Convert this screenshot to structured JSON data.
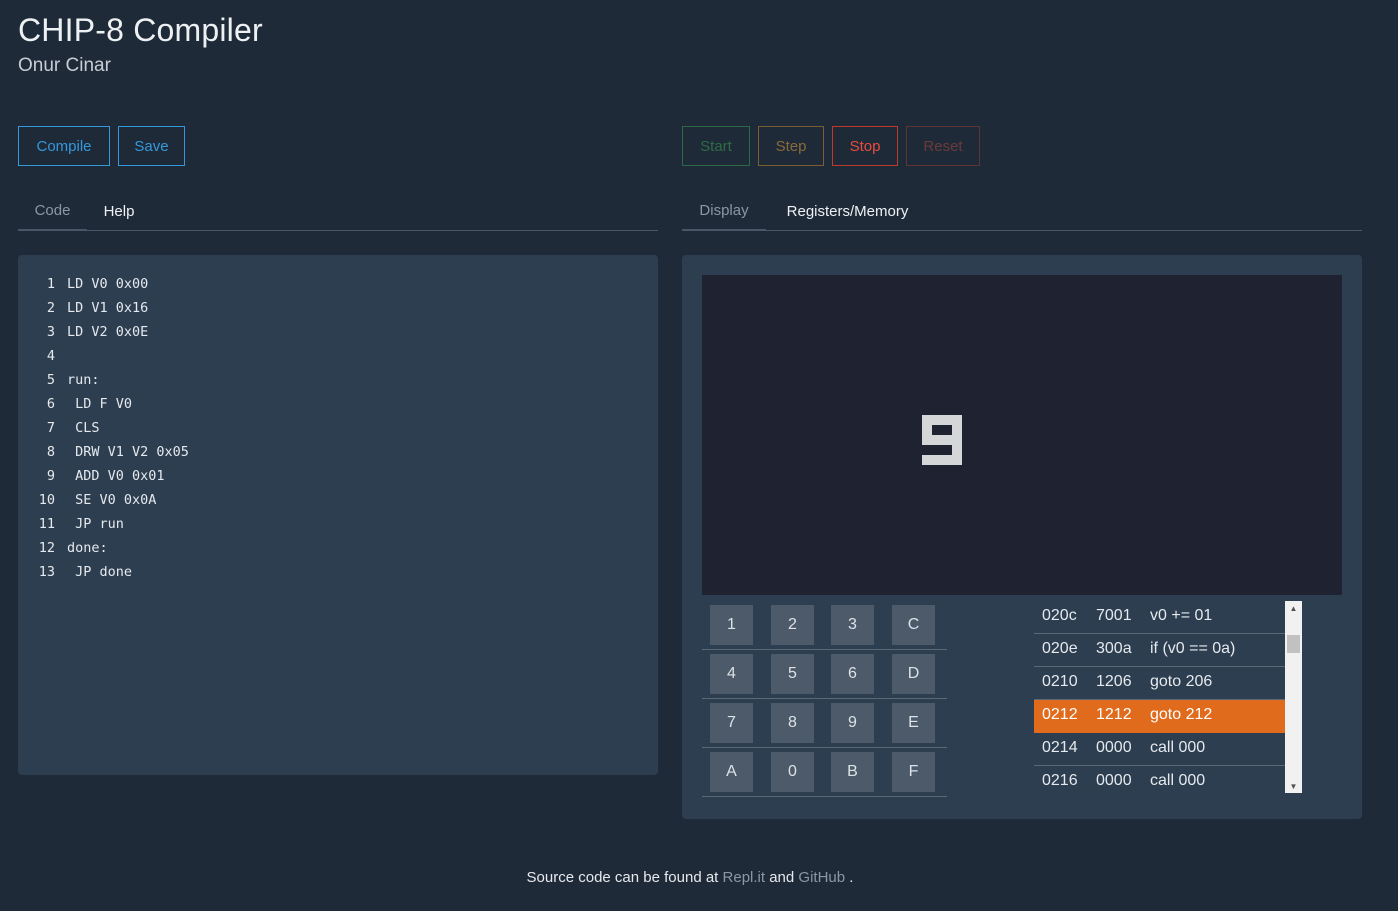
{
  "header": {
    "title": "CHIP-8 Compiler",
    "subtitle": "Onur Cinar"
  },
  "toolbar": {
    "compile_label": "Compile",
    "save_label": "Save",
    "start_label": "Start",
    "step_label": "Step",
    "stop_label": "Stop",
    "reset_label": "Reset"
  },
  "left_tabs": [
    {
      "label": "Code"
    },
    {
      "label": "Help"
    }
  ],
  "right_tabs": [
    {
      "label": "Display"
    },
    {
      "label": "Registers/Memory"
    }
  ],
  "code": [
    {
      "n": "1",
      "text": "LD V0 0x00"
    },
    {
      "n": "2",
      "text": "LD V1 0x16"
    },
    {
      "n": "3",
      "text": "LD V2 0x0E"
    },
    {
      "n": "4",
      "text": ""
    },
    {
      "n": "5",
      "text": "run:"
    },
    {
      "n": "6",
      "text": " LD F V0"
    },
    {
      "n": "7",
      "text": " CLS"
    },
    {
      "n": "8",
      "text": " DRW V1 V2 0x05"
    },
    {
      "n": "9",
      "text": " ADD V0 0x01"
    },
    {
      "n": "10",
      "text": " SE V0 0x0A"
    },
    {
      "n": "11",
      "text": " JP run"
    },
    {
      "n": "12",
      "text": "done:"
    },
    {
      "n": "13",
      "text": " JP done"
    }
  ],
  "display": {
    "glyph_rows": [
      "1111",
      "1001",
      "1111",
      "0001",
      "1111"
    ],
    "pixel_color": "#d4d6d8",
    "background_color": "#1f2230"
  },
  "keypad": [
    [
      "1",
      "2",
      "3",
      "C"
    ],
    [
      "4",
      "5",
      "6",
      "D"
    ],
    [
      "7",
      "8",
      "9",
      "E"
    ],
    [
      "A",
      "0",
      "B",
      "F"
    ]
  ],
  "memory": [
    {
      "addr": "020c",
      "op": "7001",
      "desc": "v0 += 01",
      "current": false
    },
    {
      "addr": "020e",
      "op": "300a",
      "desc": "if (v0 == 0a)",
      "current": false
    },
    {
      "addr": "0210",
      "op": "1206",
      "desc": "goto 206",
      "current": false
    },
    {
      "addr": "0212",
      "op": "1212",
      "desc": "goto 212",
      "current": true
    },
    {
      "addr": "0214",
      "op": "0000",
      "desc": "call 000",
      "current": false
    },
    {
      "addr": "0216",
      "op": "0000",
      "desc": "call 000",
      "current": false
    }
  ],
  "memory_highlight_color": "#e06b1c",
  "footer": {
    "prefix": "Source code can be found at",
    "link1": "Repl.it",
    "and": "and",
    "link2": "GitHub",
    "suffix": "."
  }
}
